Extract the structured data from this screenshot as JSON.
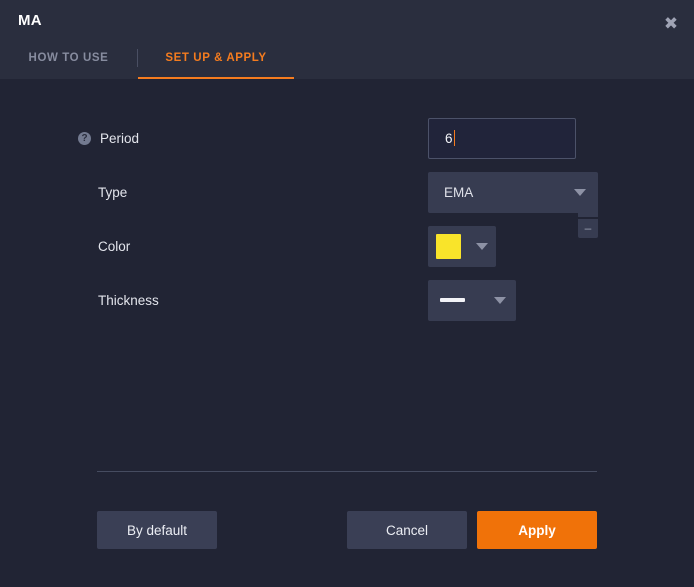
{
  "window": {
    "title": "MA",
    "close_icon": "close-icon",
    "close_glyph": "✖"
  },
  "tabs": [
    {
      "label": "HOW TO USE",
      "active": false
    },
    {
      "label": "SET UP & APPLY",
      "active": true
    }
  ],
  "form": {
    "period": {
      "label": "Period",
      "help_icon": "help-icon",
      "help_glyph": "?",
      "value": "6",
      "increment_label": "+",
      "decrement_label": "–"
    },
    "type": {
      "label": "Type",
      "value": "EMA",
      "dropdown_icon": "chevron-down-icon"
    },
    "color": {
      "label": "Color",
      "value": "#f9e42a",
      "dropdown_icon": "chevron-down-icon"
    },
    "thickness": {
      "label": "Thickness",
      "value": "thin-line",
      "dropdown_icon": "chevron-down-icon"
    }
  },
  "footer": {
    "by_default_label": "By default",
    "cancel_label": "Cancel",
    "apply_label": "Apply"
  },
  "colors": {
    "accent": "#f57c1f",
    "apply_button": "#f07209",
    "header_bg": "#2a2e3e",
    "body_bg": "#212434",
    "control_bg": "#373c51",
    "swatch": "#f9e42a"
  }
}
